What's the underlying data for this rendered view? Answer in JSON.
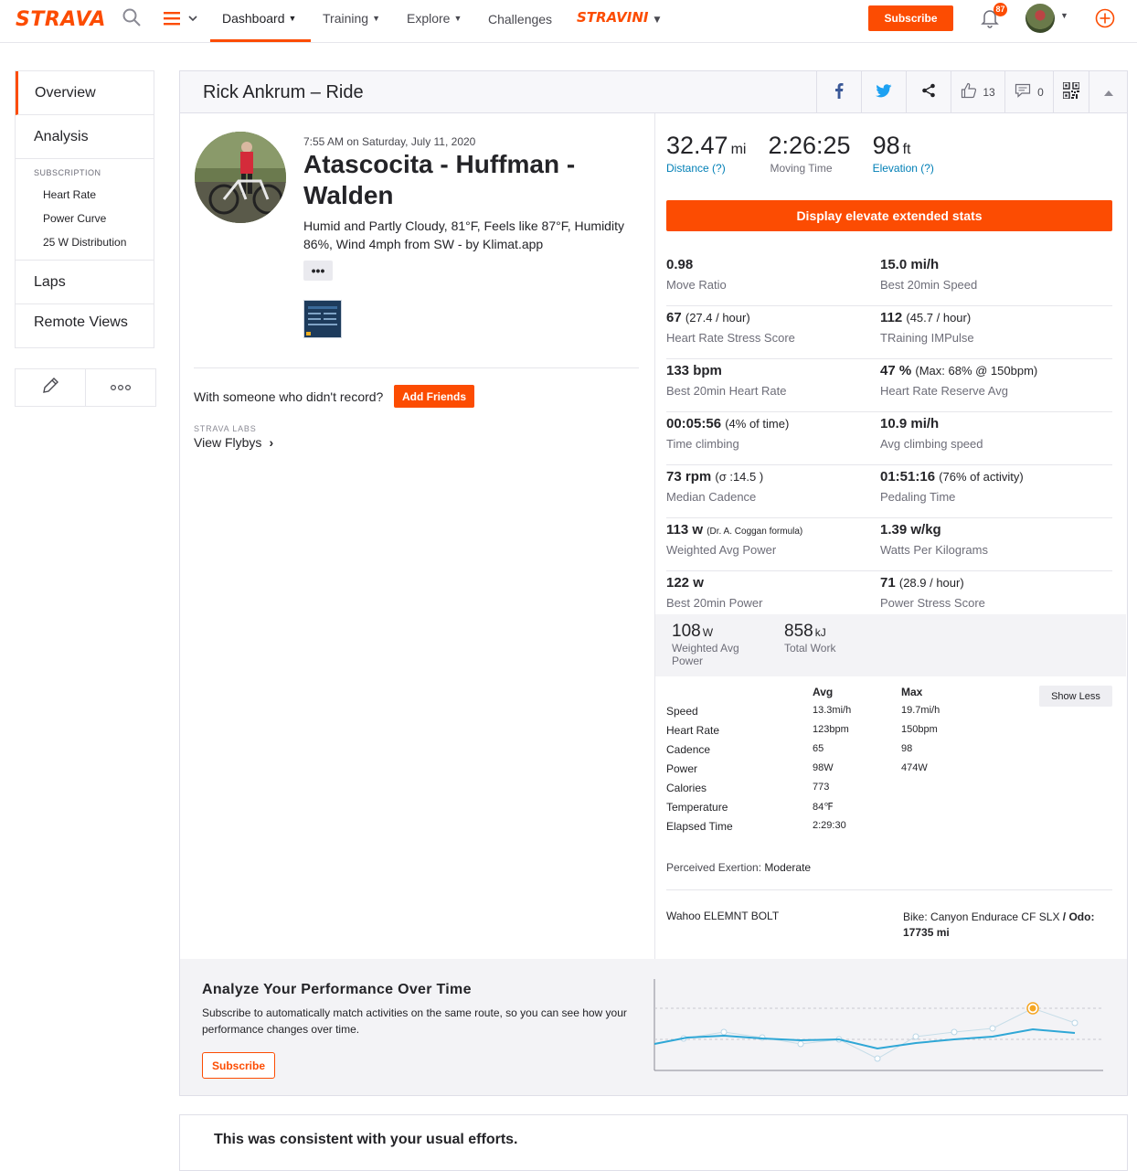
{
  "nav": {
    "logo": "STRAVA",
    "items": [
      "Dashboard",
      "Training",
      "Explore",
      "Challenges"
    ],
    "stravini": "STRAVINI",
    "subscribe": "Subscribe",
    "notifications_count": "87"
  },
  "sidebar": {
    "overview": "Overview",
    "analysis": "Analysis",
    "subscription_label": "SUBSCRIPTION",
    "sub_items": [
      "Heart Rate",
      "Power Curve",
      "25 W Distribution"
    ],
    "laps": "Laps",
    "remote_views": "Remote Views"
  },
  "header": {
    "title": "Rick Ankrum – Ride",
    "kudos": "13",
    "comments": "0"
  },
  "activity": {
    "date": "7:55 AM on Saturday, July 11, 2020",
    "name": "Atascocita - Huffman - Walden",
    "description": "Humid and Partly Cloudy, 81°F, Feels like 87°F, Humidity 86%, Wind 4mph from SW - by Klimat.app",
    "more": "•••",
    "someone_text": "With someone who didn't record?",
    "add_friends": "Add Friends",
    "labs_label": "STRAVA LABS",
    "flybys": "View Flybys"
  },
  "stats": {
    "distance": {
      "value": "32.47",
      "unit": "mi",
      "label": "Distance (?)"
    },
    "moving_time": {
      "value": "2:26:25",
      "label": "Moving Time"
    },
    "elevation": {
      "value": "98",
      "unit": "ft",
      "label": "Elevation (?)"
    },
    "elevate_button": "Display elevate extended stats"
  },
  "extended": [
    [
      {
        "v": "0.98",
        "x": "",
        "l": "Move Ratio"
      },
      {
        "v": "15.0 mi/h",
        "x": "",
        "l": "Best 20min Speed"
      }
    ],
    [
      {
        "v": "67",
        "x": "(27.4 / hour)",
        "l": "Heart Rate Stress Score"
      },
      {
        "v": "112",
        "x": "(45.7 / hour)",
        "l": "TRaining IMPulse"
      }
    ],
    [
      {
        "v": "133 bpm",
        "x": "",
        "l": "Best 20min Heart Rate"
      },
      {
        "v": "47 %",
        "x": "(Max: 68% @ 150bpm)",
        "l": "Heart Rate Reserve Avg"
      }
    ],
    [
      {
        "v": "00:05:56",
        "x": "(4% of time)",
        "l": "Time climbing"
      },
      {
        "v": "10.9 mi/h",
        "x": "",
        "l": "Avg climbing speed"
      }
    ],
    [
      {
        "v": "73 rpm",
        "x": "(σ :14.5 )",
        "l": "Median Cadence"
      },
      {
        "v": "01:51:16",
        "x": "(76% of activity)",
        "l": "Pedaling Time"
      }
    ],
    [
      {
        "v": "113 w",
        "xs": "(Dr. A. Coggan formula)",
        "l": "Weighted Avg Power"
      },
      {
        "v": "1.39 w/kg",
        "x": "",
        "l": "Watts Per Kilograms"
      }
    ],
    [
      {
        "v": "122 w",
        "x": "",
        "l": "Best 20min Power"
      },
      {
        "v": "71",
        "x": "(28.9 / hour)",
        "l": "Power Stress Score"
      }
    ]
  ],
  "power": {
    "weighted_value": "108",
    "weighted_unit": "W",
    "weighted_label": "Weighted Avg Power",
    "work_value": "858",
    "work_unit": "kJ",
    "work_label": "Total Work"
  },
  "table": {
    "avg_header": "Avg",
    "max_header": "Max",
    "show_less": "Show Less",
    "rows": [
      {
        "label": "Speed",
        "avg": "13.3mi/h",
        "max": "19.7mi/h"
      },
      {
        "label": "Heart Rate",
        "avg": "123bpm",
        "max": "150bpm"
      },
      {
        "label": "Cadence",
        "avg": "65",
        "max": "98"
      },
      {
        "label": "Power",
        "avg": "98W",
        "max": "474W"
      },
      {
        "label": "Calories",
        "avg": "773",
        "max": ""
      },
      {
        "label": "Temperature",
        "avg": "84℉",
        "max": ""
      },
      {
        "label": "Elapsed Time",
        "avg": "2:29:30",
        "max": ""
      }
    ]
  },
  "exertion": {
    "label": "Perceived Exertion:",
    "value": "Moderate"
  },
  "device": "Wahoo ELEMNT BOLT",
  "bike": {
    "label": "Bike:",
    "name": "Canyon Endurace CF SLX",
    "odo_label": "/ Odo:",
    "odo": "17735 mi"
  },
  "analyze": {
    "title": "Analyze Your Performance Over Time",
    "text": "Subscribe to automatically match activities on the same route, so you can see how your performance changes over time.",
    "subscribe": "Subscribe"
  },
  "consistent": {
    "title": "This was consistent with your usual efforts."
  },
  "colors": {
    "brand": "#fc4c02",
    "link": "#007fb6"
  }
}
